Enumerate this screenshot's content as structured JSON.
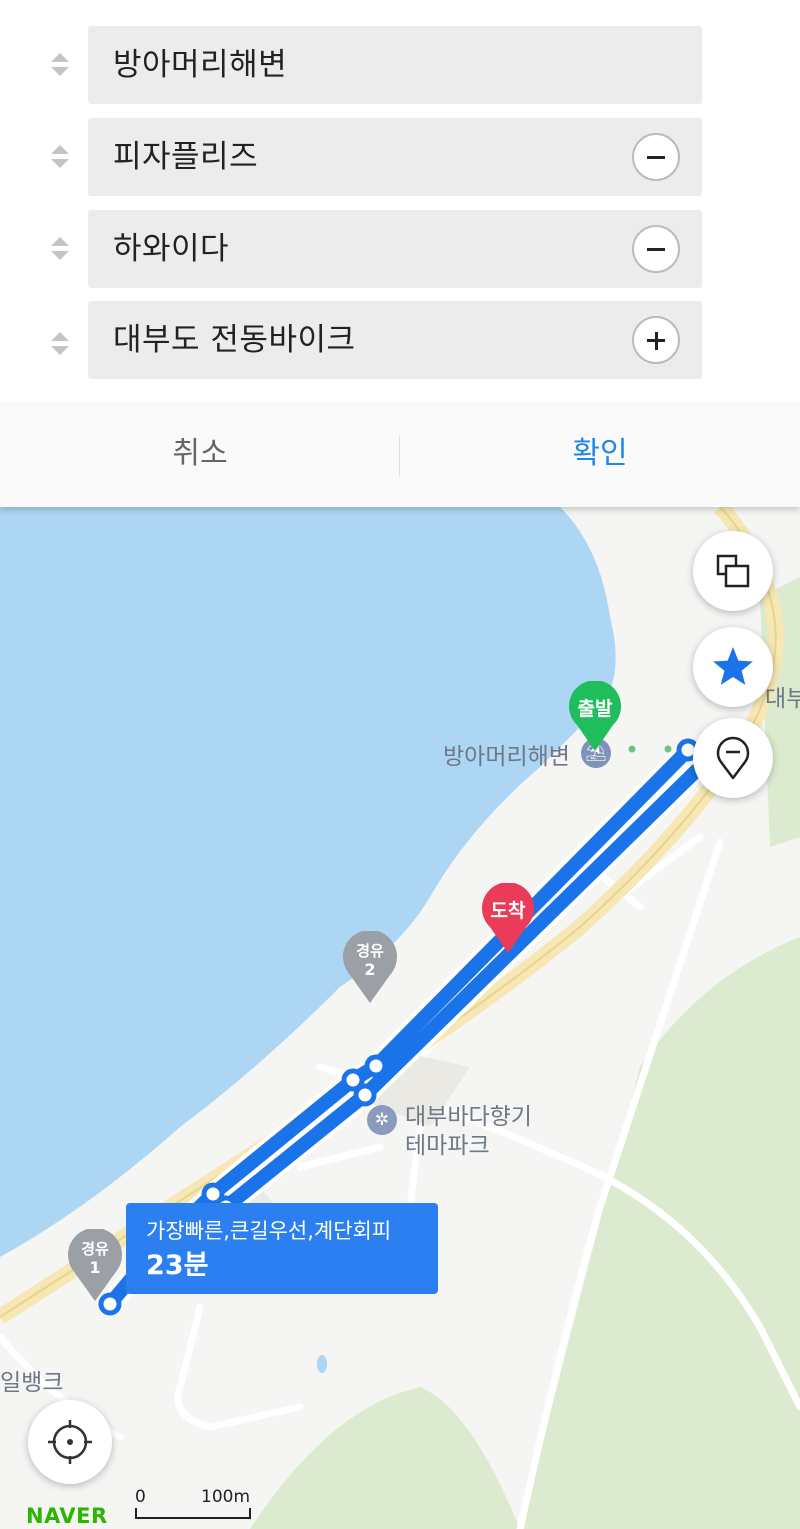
{
  "waypoints": [
    {
      "label": "방아머리해변",
      "action": "none"
    },
    {
      "label": "피자플리즈",
      "action": "remove"
    },
    {
      "label": "하와이다",
      "action": "remove"
    },
    {
      "label": "대부도 전동바이크",
      "action": "add"
    }
  ],
  "actions": {
    "cancel": "취소",
    "confirm": "확인"
  },
  "map": {
    "labels": {
      "start_poi": "방아머리해변",
      "theme_park_line1": "대부바다향기",
      "theme_park_line2": "테마파크",
      "left_edge": "일뱅크",
      "right_edge": "대부"
    },
    "pins": {
      "start": "출발",
      "end": "도착",
      "via1_line1": "경유",
      "via1_line2": "1",
      "via2_line1": "경유",
      "via2_line2": "2"
    },
    "route": {
      "description": "가장빠른,큰길우선,계단회피",
      "duration": "23분"
    },
    "scale": {
      "start": "0",
      "end": "100m"
    },
    "logo": "NAVER",
    "colors": {
      "water": "#acd6f4",
      "route": "#1a73e8",
      "start_pin": "#1fbd5c",
      "end_pin": "#ea3b58",
      "via_pin": "#9aa0a6",
      "accent": "#1e88e5",
      "park": "#dcebcf"
    }
  }
}
